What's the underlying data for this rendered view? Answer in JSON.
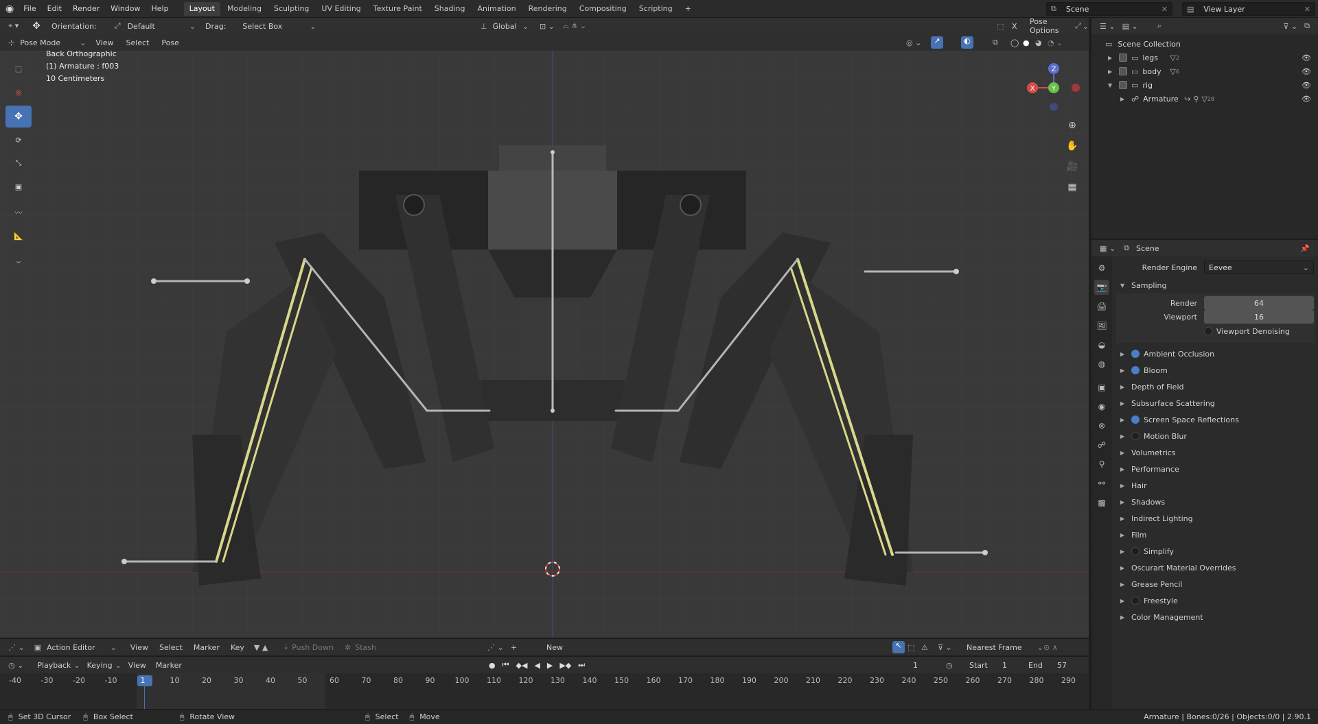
{
  "menu": {
    "items": [
      "File",
      "Edit",
      "Render",
      "Window",
      "Help"
    ],
    "workspaces": [
      "Layout",
      "Modeling",
      "Sculpting",
      "UV Editing",
      "Texture Paint",
      "Shading",
      "Animation",
      "Rendering",
      "Compositing",
      "Scripting"
    ],
    "active_workspace": "Layout",
    "scene": "Scene",
    "view_layer": "View Layer"
  },
  "viewport_header": {
    "orientation_label": "Orientation:",
    "orientation_value": "Default",
    "drag_label": "Drag:",
    "drag_value": "Select Box",
    "transform_orientation": "Global",
    "x_label": "X",
    "pose_options": "Pose Options"
  },
  "viewport_header2": {
    "mode": "Pose Mode",
    "menus": [
      "View",
      "Select",
      "Pose"
    ]
  },
  "viewport_info": {
    "view_name": "Back Orthographic",
    "object_line": "(1) Armature : f003",
    "scale_line": "10 Centimeters"
  },
  "gizmo": {
    "z": "Z",
    "x": "X",
    "y": "Y"
  },
  "outliner": {
    "root": "Scene Collection",
    "rows": [
      {
        "name": "legs",
        "badge": "2"
      },
      {
        "name": "body",
        "badge": "6"
      },
      {
        "name": "rig",
        "badge": ""
      },
      {
        "name": "Armature",
        "badge": "28"
      }
    ]
  },
  "properties": {
    "header_title": "Scene",
    "render_engine_label": "Render Engine",
    "render_engine_value": "Eevee",
    "sampling_label": "Sampling",
    "render_label": "Render",
    "render_value": "64",
    "viewport_label": "Viewport",
    "viewport_value": "16",
    "denoising_label": "Viewport Denoising",
    "sections": [
      {
        "label": "Ambient Occlusion",
        "toggle": "blue"
      },
      {
        "label": "Bloom",
        "toggle": "blue"
      },
      {
        "label": "Depth of Field",
        "toggle": "none"
      },
      {
        "label": "Subsurface Scattering",
        "toggle": "none"
      },
      {
        "label": "Screen Space Reflections",
        "toggle": "blue"
      },
      {
        "label": "Motion Blur",
        "toggle": "dark"
      },
      {
        "label": "Volumetrics",
        "toggle": "none"
      },
      {
        "label": "Performance",
        "toggle": "none"
      },
      {
        "label": "Hair",
        "toggle": "none"
      },
      {
        "label": "Shadows",
        "toggle": "none"
      },
      {
        "label": "Indirect Lighting",
        "toggle": "none"
      },
      {
        "label": "Film",
        "toggle": "none"
      },
      {
        "label": "Simplify",
        "toggle": "dark"
      },
      {
        "label": "Oscurart Material Overrides",
        "toggle": "none"
      },
      {
        "label": "Grease Pencil",
        "toggle": "none"
      },
      {
        "label": "Freestyle",
        "toggle": "dark"
      },
      {
        "label": "Color Management",
        "toggle": "none"
      }
    ]
  },
  "action_editor": {
    "editor_name": "Action Editor",
    "menus": [
      "View",
      "Select",
      "Marker",
      "Key"
    ],
    "push_down": "Push Down",
    "stash": "Stash",
    "new": "New",
    "snap": "Nearest Frame"
  },
  "timeline": {
    "menus": [
      "Playback",
      "Keying",
      "View",
      "Marker"
    ],
    "current_frame": "1",
    "start_label": "Start",
    "start_value": "1",
    "end_label": "End",
    "end_value": "57",
    "ticks": [
      "-40",
      "-30",
      "-20",
      "-10",
      "1",
      "10",
      "20",
      "30",
      "40",
      "50",
      "60",
      "70",
      "80",
      "90",
      "100",
      "110",
      "120",
      "130",
      "140",
      "150",
      "160",
      "170",
      "180",
      "190",
      "200",
      "210",
      "220",
      "230",
      "240",
      "250",
      "260",
      "270",
      "280",
      "290"
    ]
  },
  "status": {
    "items": [
      "Set 3D Cursor",
      "Box Select",
      "Rotate View",
      "Select",
      "Move"
    ],
    "right": "Armature | Bones:0/26 | Objects:0/0 | 2.90.1"
  }
}
